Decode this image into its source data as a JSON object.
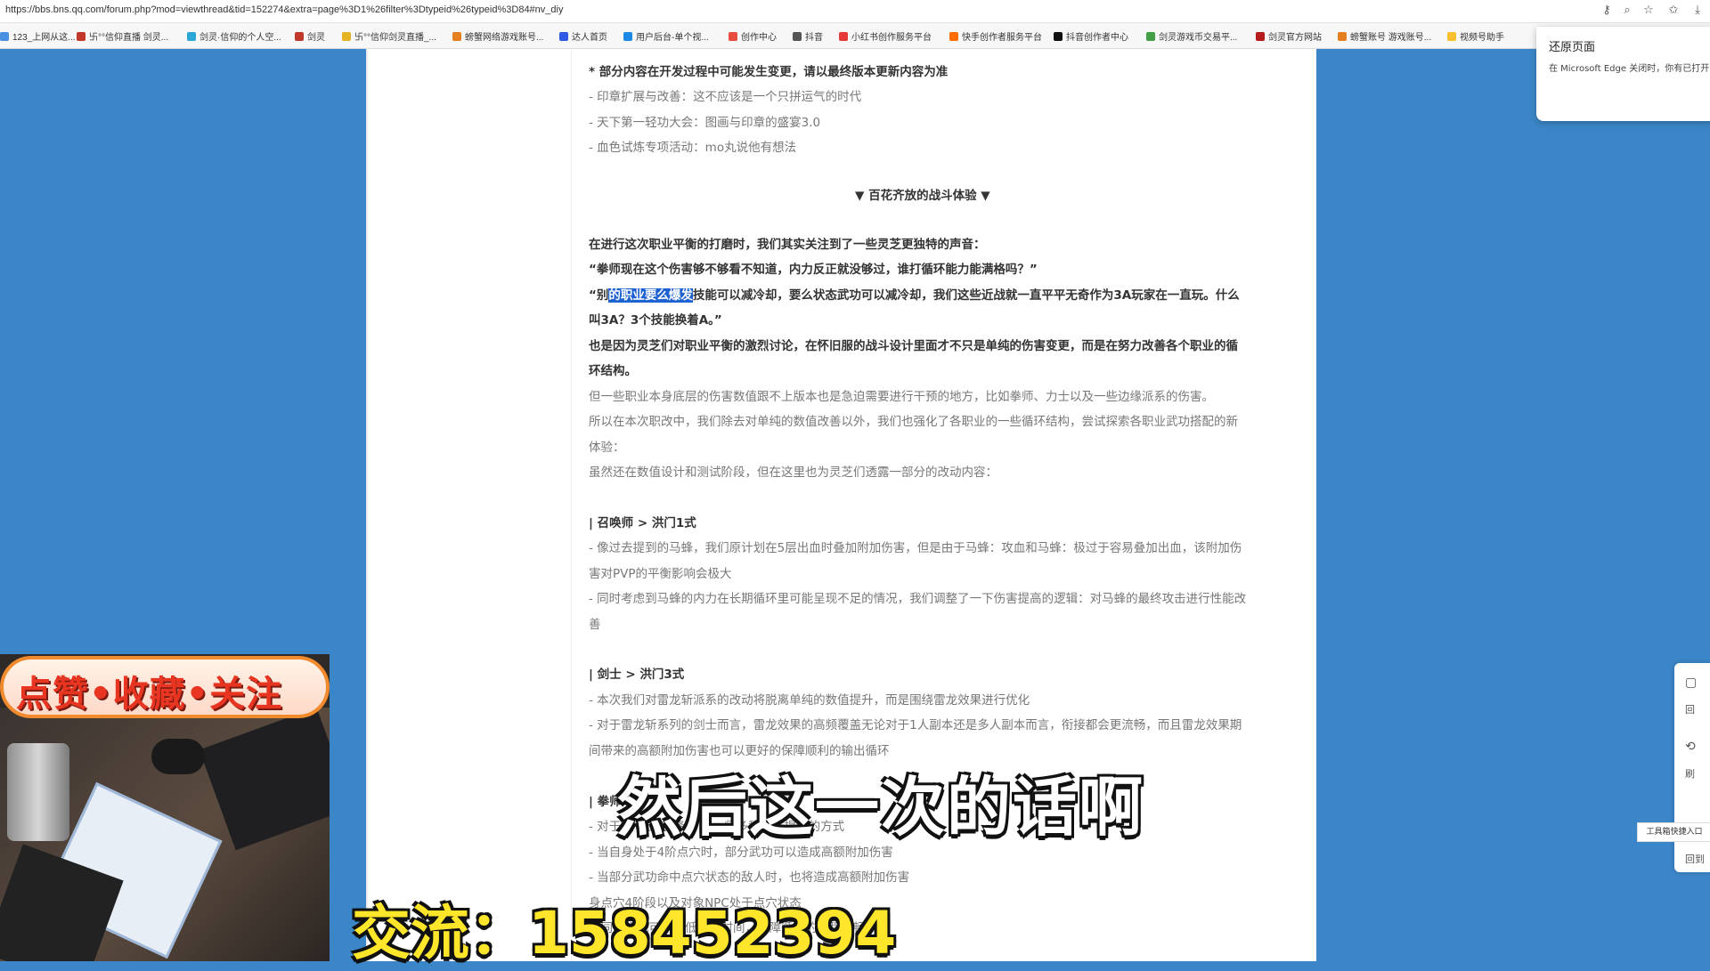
{
  "address_bar": {
    "url": "https://bbs.bns.qq.com/forum.php?mod=viewthread&tid=152274&extra=page%3D1%26filter%3Dtypeid%26typeid%3D84#nv_diy"
  },
  "bookmarks": [
    {
      "label": "123_上网从这...",
      "color": "#4a90e2"
    },
    {
      "label": "卐°°信仰直播 剑灵...",
      "color": "#c0392b"
    },
    {
      "label": "剑灵·信仰的个人空...",
      "color": "#2aa6d8"
    },
    {
      "label": "剑灵",
      "color": "#c0392b"
    },
    {
      "label": "卐°°信仰剑灵直播_...",
      "color": "#e6b325"
    },
    {
      "label": "螃蟹网络游戏账号...",
      "color": "#e67e22"
    },
    {
      "label": "达人首页",
      "color": "#2d5be3"
    },
    {
      "label": "用户后台-单个视...",
      "color": "#1e88e5"
    },
    {
      "label": "创作中心",
      "color": "#e74c3c"
    },
    {
      "label": "抖音",
      "color": "#555555"
    },
    {
      "label": "小红书创作服务平台",
      "color": "#e53935"
    },
    {
      "label": "快手创作者服务平台",
      "color": "#ff6d00"
    },
    {
      "label": "抖音创作者中心",
      "color": "#111111"
    },
    {
      "label": "剑灵游戏币交易平...",
      "color": "#43a047"
    },
    {
      "label": "剑灵官方网站",
      "color": "#b71c1c"
    },
    {
      "label": "螃蟹账号 游戏账号...",
      "color": "#e67e22"
    },
    {
      "label": "视频号助手",
      "color": "#fbc02d"
    }
  ],
  "restore_popup": {
    "title": "还原页面",
    "desc": "在 Microsoft Edge 关闭时，你有已打开"
  },
  "article": {
    "lines": [
      {
        "text": "* 部分内容在开发过程中可能发生变更，请以最终版本更新内容为准",
        "bold": true
      },
      {
        "text": "- 印章扩展与改善：这不应该是一个只拼运气的时代"
      },
      {
        "text": "- 天下第一轻功大会：图画与印章的盛宴3.0"
      },
      {
        "text": "- 血色试炼专项活动：mo丸说他有想法"
      },
      {
        "text": "▼ 百花齐放的战斗体验 ▼",
        "bold": true,
        "center": true
      },
      {
        "text": "在进行这次职业平衡的打磨时，我们其实关注到了一些灵芝更独特的声音：",
        "bold": true
      },
      {
        "text": "“拳师现在这个伤害够不够看不知道，内力反正就没够过，谁打循环能力能满格吗？”",
        "bold": true
      },
      {
        "pre": "“别",
        "hl": "的职业要么爆发",
        "post": "技能可以减冷却，要么状态武功可以减冷却，我们这些近战就一直平平无奇作为3A玩家在一直玩。什么",
        "bold": true
      },
      {
        "text": "叫3A？3个技能换着A。”",
        "bold": true
      },
      {
        "text": "也是因为灵芝们对职业平衡的激烈讨论，在怀旧服的战斗设计里面才不只是单纯的伤害变更，而是在努力改善各个职业的循",
        "bold": true
      },
      {
        "text": "环结构。",
        "bold": true
      },
      {
        "text": "但一些职业本身底层的伤害数值跟不上版本也是急迫需要进行干预的地方，比如拳师、力士以及一些边缘派系的伤害。"
      },
      {
        "text": "所以在本次职改中，我们除去对单纯的数值改善以外，我们也强化了各职业的一些循环结构，尝试探索各职业武功搭配的新"
      },
      {
        "text": "体验："
      },
      {
        "text": "虽然还在数值设计和测试阶段，但在这里也为灵芝们透露一部分的改动内容："
      },
      {
        "text": "| 召唤师 > 洪门1式",
        "bold": true
      },
      {
        "text": "- 像过去提到的马蜂，我们原计划在5层出血时叠加附加伤害，但是由于马蜂：攻血和马蜂：极过于容易叠加出血，该附加伤"
      },
      {
        "text": "害对PVP的平衡影响会极大"
      },
      {
        "text": "- 同时考虑到马蜂的内力在长期循环里可能呈现不足的情况，我们调整了一下伤害提高的逻辑：对马蜂的最终攻击进行性能改"
      },
      {
        "text": "善"
      },
      {
        "text": "| 剑士 > 洪门3式",
        "bold": true
      },
      {
        "text": "- 本次我们对雷龙斩派系的改动将脱离单纯的数值提升，而是围绕雷龙效果进行优化"
      },
      {
        "text": "- 对于雷龙斩系列的剑士而言，雷龙效果的高频覆盖无论对于1人副本还是多人副本而言，衔接都会更流畅，而且雷龙效果期"
      },
      {
        "text": "间带来的高额附加伤害也可以更好的保障顺利的输出循环"
      },
      {
        "text": "| 拳师",
        "bold": true
      },
      {
        "text": "- 对于                                                           许多武功降低了...                                                              师多种伤害提高的方式"
      },
      {
        "text": "- 当自身处于4阶点穴时，部分武功可以造成高额附加伤害"
      },
      {
        "text": "- 当部分武功命中点穴状态的敌人时，也将造成高额附加伤害"
      },
      {
        "text": "                                                                                                身点穴4阶段以及对象NPC处于点穴状态"
      },
      {
        "text": "                                                                                                不同的方式可以降低冷却时间，保障循环的全程顺畅"
      }
    ]
  },
  "side_tools": {
    "items": [
      "回",
      "刷",
      "回到"
    ],
    "tooltip": "工具箱快捷入口"
  },
  "overlay": {
    "banner": "点赞•收藏•关注",
    "subtitle": "然后这一次的话啊",
    "contact": "交流：158452394"
  }
}
